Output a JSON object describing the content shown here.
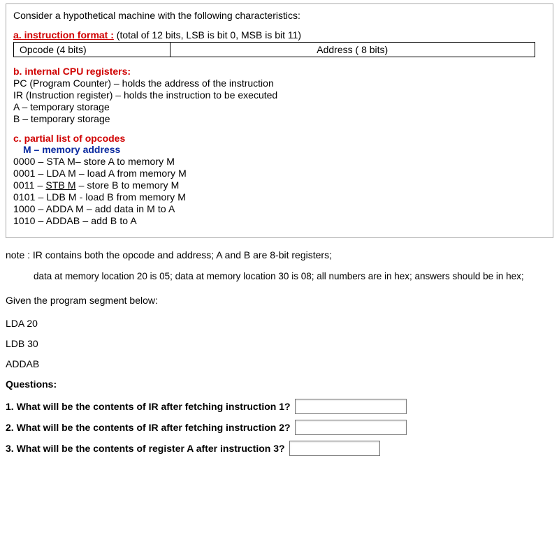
{
  "intro": "Consider a hypothetical machine with the following characteristics:",
  "sec_a": {
    "heading": "a. instruction format :",
    "heading_extra": " (total of 12 bits, LSB is bit 0, MSB is bit 11)",
    "opcode_cell": "Opcode (4 bits)",
    "address_cell": "Address ( 8 bits)"
  },
  "sec_b": {
    "heading": "b. internal CPU registers:",
    "lines": [
      "PC (Program Counter) – holds the address of the instruction",
      "IR (Instruction register) – holds the instruction to be executed",
      "A – temporary storage",
      "B – temporary storage"
    ]
  },
  "sec_c": {
    "heading": "c. partial list of opcodes",
    "mem_label": "M – memory address",
    "ops": [
      "0000 – STA M– store A to memory M",
      "0001 – LDA M – load A from memory M",
      "0011 – STB  M – store B to memory M",
      "0101 – LDB M - load B from memory M",
      "1000 – ADDA M – add data in M to A",
      "1010 – ADDAB – add B to A"
    ],
    "op2_pre": "0011 – ",
    "op2_u": "STB  M",
    "op2_post": " – store B to memory M"
  },
  "note1": "note : IR contains both the opcode and address; A and B are 8-bit registers;",
  "note2": "data at memory location 20 is 05; data at memory location 30 is 08; all numbers are in hex; answers should be in hex;",
  "given": "Given the program segment below:",
  "prog": [
    "LDA 20",
    "LDB 30",
    "ADDAB"
  ],
  "questions_hdr": "Questions:",
  "q1": "1. What will be the contents of IR after fetching instruction 1?",
  "q2": "2. What will be the contents of IR after fetching instruction 2?",
  "q3": "3. What will be the contents of register A after instruction 3?"
}
